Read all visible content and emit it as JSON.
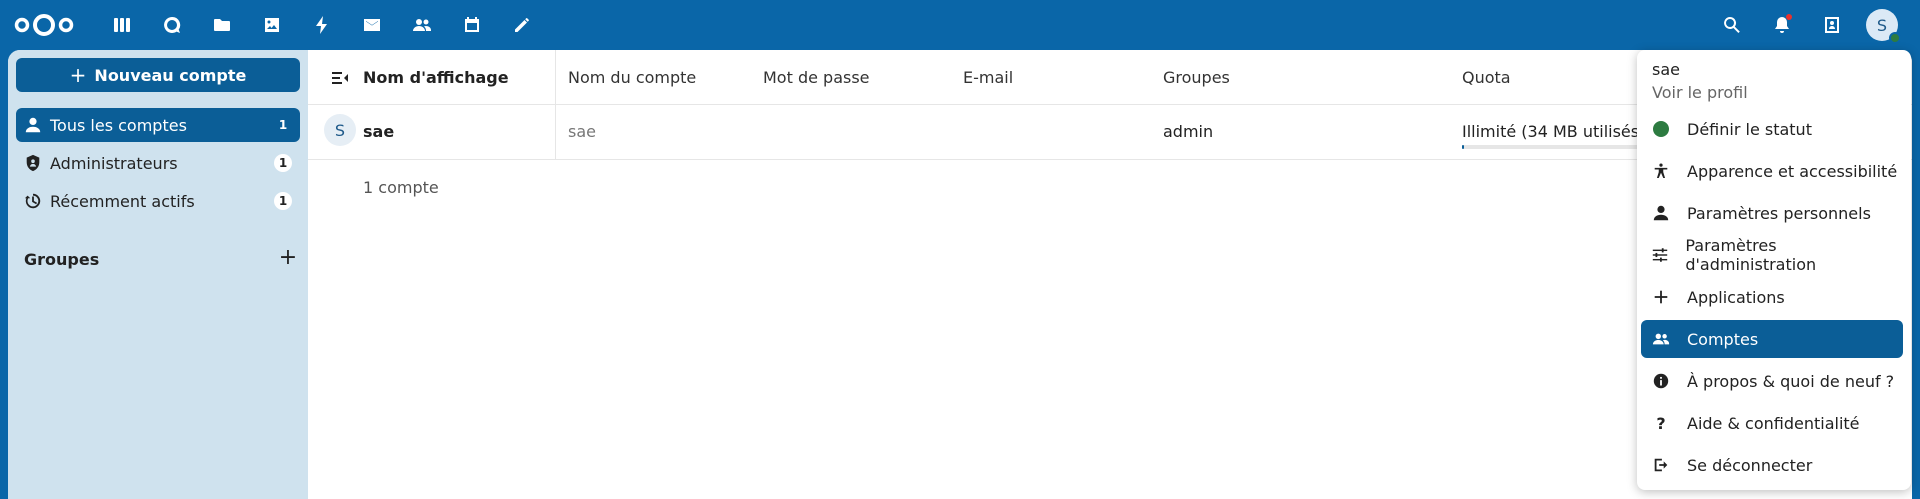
{
  "header": {
    "apps": [
      {
        "name": "dashboard-icon"
      },
      {
        "name": "talk-icon"
      },
      {
        "name": "files-icon"
      },
      {
        "name": "photos-icon"
      },
      {
        "name": "activity-icon"
      },
      {
        "name": "mail-icon"
      },
      {
        "name": "contacts-icon"
      },
      {
        "name": "calendar-icon"
      },
      {
        "name": "notes-icon"
      }
    ],
    "avatar_initial": "S"
  },
  "sidebar": {
    "new_account": "Nouveau compte",
    "items": [
      {
        "label": "Tous les comptes",
        "count": "1",
        "active": true
      },
      {
        "label": "Administrateurs",
        "count": "1",
        "active": false
      },
      {
        "label": "Récemment actifs",
        "count": "1",
        "active": false
      }
    ],
    "groups_title": "Groupes"
  },
  "table": {
    "columns": {
      "display_name": "Nom d'affichage",
      "account_name": "Nom du compte",
      "password": "Mot de passe",
      "email": "E-mail",
      "groups": "Groupes",
      "quota": "Quota"
    },
    "rows": [
      {
        "avatar": "S",
        "display_name": "sae",
        "account_name": "sae",
        "groups": "admin",
        "quota": "Illimité (34 MB utilisés)"
      }
    ],
    "footer": "1 compte"
  },
  "menu": {
    "user": "sae",
    "profile_link": "Voir le profil",
    "items": [
      {
        "label": "Définir le statut",
        "icon": "status-icon"
      },
      {
        "label": "Apparence et accessibilité",
        "icon": "accessibility-icon"
      },
      {
        "label": "Paramètres personnels",
        "icon": "person-icon"
      },
      {
        "label": "Paramètres d'administration",
        "icon": "sliders-icon"
      },
      {
        "label": "Applications",
        "icon": "plus-icon"
      },
      {
        "label": "Comptes",
        "icon": "accounts-icon",
        "active": true
      },
      {
        "label": "À propos & quoi de neuf ?",
        "icon": "info-icon"
      },
      {
        "label": "Aide & confidentialité",
        "icon": "help-icon"
      },
      {
        "label": "Se déconnecter",
        "icon": "logout-icon"
      }
    ]
  },
  "colors": {
    "brand": "#0a66a8",
    "active": "#0b5e97",
    "sidebar_bg": "#cfe2ee",
    "status_online": "#2d7b41"
  }
}
